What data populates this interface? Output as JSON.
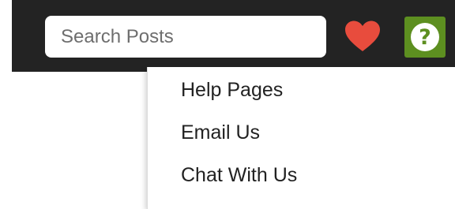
{
  "header": {
    "search": {
      "placeholder": "Search Posts",
      "value": ""
    },
    "favorites_icon": "heart-icon",
    "help_icon": "question-mark-icon",
    "colors": {
      "bar": "#232323",
      "heart": "#e84c3d",
      "help_button": "#5d8f20"
    }
  },
  "help_menu": {
    "items": [
      {
        "label": "Help Pages"
      },
      {
        "label": "Email Us"
      },
      {
        "label": "Chat With Us"
      }
    ]
  }
}
